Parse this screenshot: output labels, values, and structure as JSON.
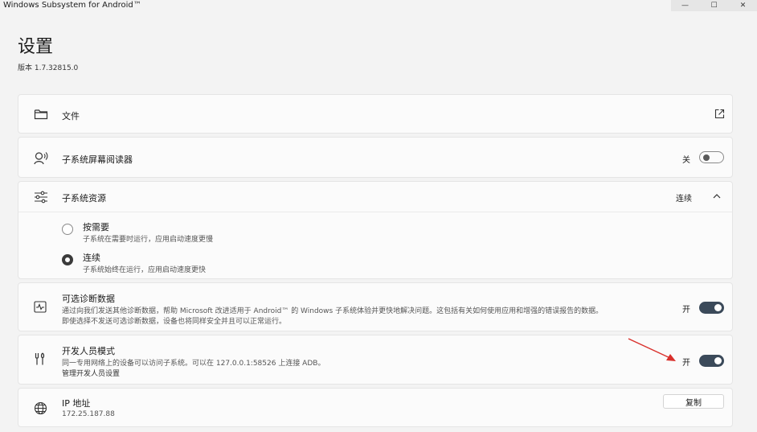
{
  "window": {
    "title": "Windows Subsystem for Android™",
    "minimize_glyph": "—",
    "maximize_glyph": "☐",
    "close_glyph": "✕"
  },
  "page": {
    "title": "设置",
    "version": "版本 1.7.32815.0"
  },
  "files": {
    "label": "文件",
    "icon": "folder-icon",
    "action_icon": "open-external-icon"
  },
  "screen_reader": {
    "label": "子系统屏幕阅读器",
    "icon": "screen-reader-icon",
    "state": "关",
    "enabled": false
  },
  "resources": {
    "label": "子系统资源",
    "icon": "sliders-icon",
    "value": "连续",
    "expanded": true,
    "options": [
      {
        "title": "按需要",
        "desc": "子系统在需要时运行，应用启动速度更慢",
        "selected": false
      },
      {
        "title": "连续",
        "desc": "子系统始终在运行，应用启动速度更快",
        "selected": true
      }
    ]
  },
  "diagnostics": {
    "label": "可选诊断数据",
    "icon": "diagnostics-icon",
    "desc_line1": "通过向我们发送其他诊断数据，帮助 Microsoft 改进适用于 Android™ 的 Windows 子系统体验并更快地解决问题。这包括有关如何使用应用和增强的错误报告的数据。",
    "desc_line2": "即使选择不发送可选诊断数据，设备也将同样安全并且可以正常运行。",
    "state": "开",
    "enabled": true
  },
  "developer": {
    "label": "开发人员模式",
    "icon": "developer-tools-icon",
    "desc": "同一专用网络上的设备可以访问子系统。可以在 127.0.0.1:58526 上连接 ADB。",
    "link": "管理开发人员设置",
    "state": "开",
    "enabled": true
  },
  "ip": {
    "label": "IP 地址",
    "icon": "globe-icon",
    "value": "172.25.187.88",
    "button": "复制"
  },
  "colors": {
    "toggle_on": "#3b4a5a",
    "annotation_arrow": "#d9302c",
    "card_bg": "#fbfbfb",
    "page_bg": "#f3f3f3"
  }
}
